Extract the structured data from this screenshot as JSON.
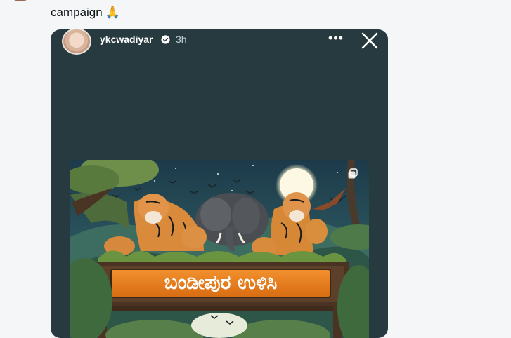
{
  "tweet": {
    "text_line": "campaign",
    "emoji": "🙏"
  },
  "story": {
    "username": "ykcwadiyar",
    "time": "3h",
    "more_label": "•••",
    "poster": {
      "banner_text": "ಬಂಡೀಪುರ ಉಳಿಸಿ"
    }
  },
  "icons": [
    "verified-icon",
    "more-icon",
    "close-icon",
    "copy-icon",
    "pray-emoji"
  ],
  "colors": {
    "page_bg": "#f5f6f7",
    "story_bg": "#263a3f",
    "banner_orange": "#e57b1b",
    "verified_blue": "#ffffff"
  }
}
